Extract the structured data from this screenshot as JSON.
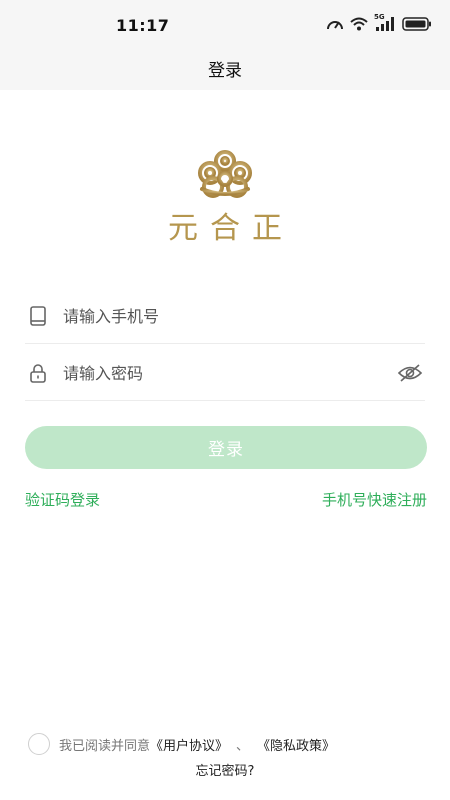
{
  "status": {
    "time": "11:17",
    "network": "5G"
  },
  "nav": {
    "title": "登录"
  },
  "logo": {
    "text": "元合正",
    "color": "#b5964e"
  },
  "form": {
    "phone": {
      "placeholder": "请输入手机号",
      "value": ""
    },
    "password": {
      "placeholder": "请输入密码",
      "value": ""
    },
    "login_label": "登录"
  },
  "links": {
    "sms_login": "验证码登录",
    "quick_register": "手机号快速注册"
  },
  "agreement": {
    "text": "我已阅读并同意",
    "user_agreement": "《用户协议》",
    "separator": "、",
    "privacy_policy": "《隐私政策》",
    "checked": false
  },
  "forgot_password": "忘记密码?",
  "colors": {
    "accent": "#2fae5a",
    "button_disabled": "#bfe7c9",
    "header_bg": "#f6f6f6"
  },
  "icons": [
    "speed-icon",
    "wifi-icon",
    "signal-icon",
    "battery-icon",
    "phone-icon",
    "lock-icon",
    "eye-off-icon",
    "cloud-logo-icon"
  ]
}
